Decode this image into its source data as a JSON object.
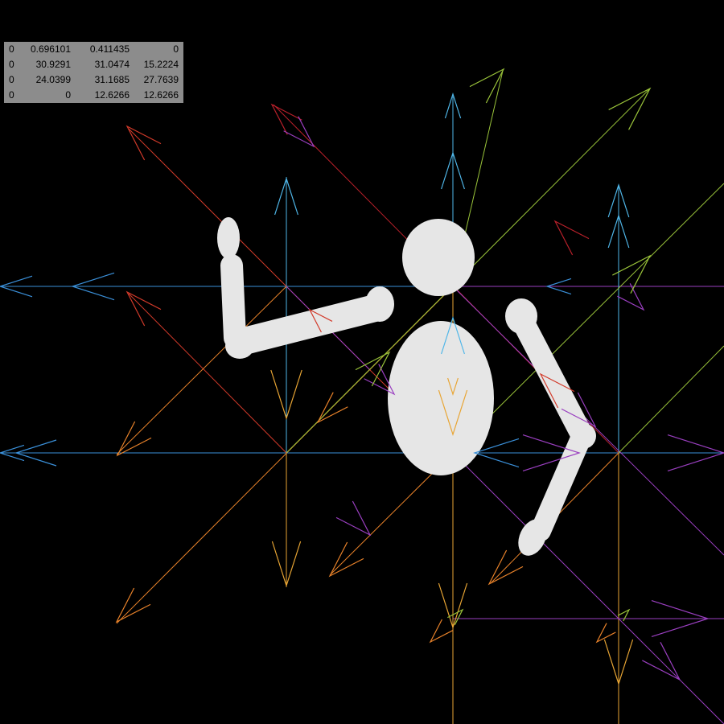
{
  "matrix": [
    [
      "0",
      "0.696101",
      "0.411435",
      "0"
    ],
    [
      "0",
      "30.9291",
      "31.0474",
      "15.2224"
    ],
    [
      "0",
      "24.0399",
      "31.1685",
      "27.7639"
    ],
    [
      "0",
      "0",
      "12.6266",
      "12.6266"
    ]
  ],
  "colors": {
    "background": "#000000",
    "figure": "#e6e6e6",
    "panel": "#8c8c8c",
    "blue": "#3a8fd8",
    "cyan": "#4fb6e8",
    "red": "#d23a2a",
    "orange": "#e8822a",
    "yellow_orange": "#e8a534",
    "purple": "#9a3fc0",
    "lime": "#9ac43a",
    "crimson": "#b8202a"
  }
}
